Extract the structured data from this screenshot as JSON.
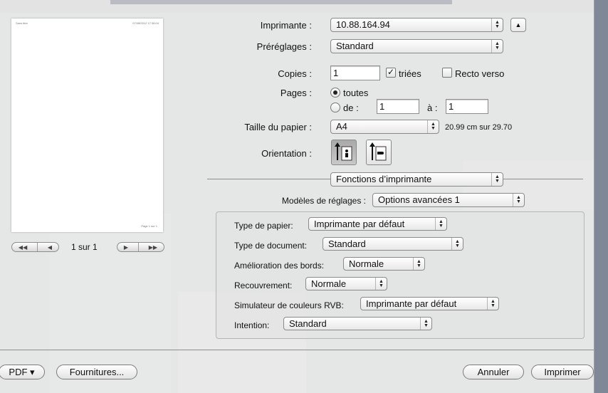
{
  "preview": {
    "header_left": "Sans titre",
    "header_right": "07/08/2012 17:36:04",
    "footer": "Page 1 sur 1",
    "page_count": "1 sur 1"
  },
  "printer": {
    "label": "Imprimante :",
    "value": "10.88.164.94"
  },
  "presets": {
    "label": "Préréglages :",
    "value": "Standard"
  },
  "copies": {
    "label": "Copies :",
    "value": "1",
    "collated_label": "triées",
    "collated": true,
    "duplex_label": "Recto verso",
    "duplex": false
  },
  "pages": {
    "label": "Pages :",
    "all_label": "toutes",
    "from_label": "de :",
    "from_value": "1",
    "to_label": "à :",
    "to_value": "1",
    "selected": "toutes"
  },
  "paper_size": {
    "label": "Taille du papier :",
    "value": "A4",
    "dimensions": "20.99 cm sur 29.70"
  },
  "orientation": {
    "label": "Orientation :",
    "selected": "portrait"
  },
  "section_popup": {
    "value": "Fonctions d’imprimante"
  },
  "feature_sets": {
    "label": "Modèles de réglages :",
    "value": "Options avancées 1"
  },
  "options": [
    {
      "label": "Type de papier:",
      "value": "Imprimante par défaut"
    },
    {
      "label": "Type de document:",
      "value": "Standard"
    },
    {
      "label": "Amélioration des bords:",
      "value": "Normale"
    },
    {
      "label": "Recouvrement:",
      "value": "Normale"
    },
    {
      "label": "Simulateur de couleurs RVB:",
      "value": "Imprimante par défaut"
    },
    {
      "label": "Intention:",
      "value": "Standard"
    }
  ],
  "bottom": {
    "pdf_label": "PDF ▾",
    "supplies_label": "Fournitures...",
    "cancel_label": "Annuler",
    "print_label": "Imprimer"
  }
}
